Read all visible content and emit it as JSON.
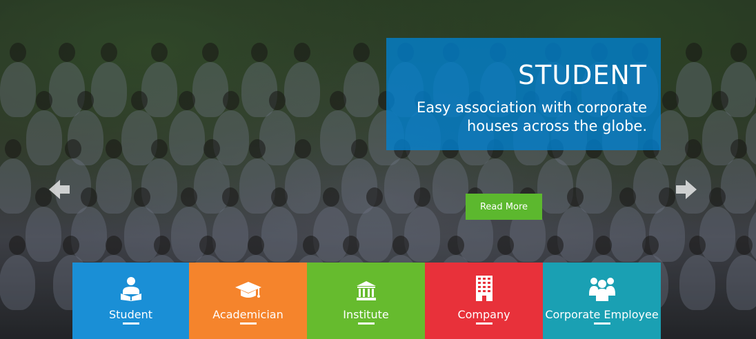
{
  "slide": {
    "title": "STUDENT",
    "description_line1": "Easy association with corporate",
    "description_line2": "houses across the globe.",
    "read_more_label": "Read More"
  },
  "colors": {
    "caption_bg": "#0082d2",
    "read_more_bg": "#5cb82e",
    "student": "#1a8fd6",
    "academician": "#f5842c",
    "institute": "#66bb2e",
    "company": "#e8313a",
    "corporate_employee": "#1aa0b3"
  },
  "categories": [
    {
      "label": "Student",
      "icon": "student-reading-icon"
    },
    {
      "label": "Academician",
      "icon": "graduation-cap-icon"
    },
    {
      "label": "Institute",
      "icon": "building-columns-icon"
    },
    {
      "label": "Company",
      "icon": "office-building-icon"
    },
    {
      "label": "Corporate Employee",
      "icon": "group-people-icon"
    }
  ],
  "nav": {
    "prev_icon": "arrow-left-icon",
    "next_icon": "arrow-right-icon"
  }
}
